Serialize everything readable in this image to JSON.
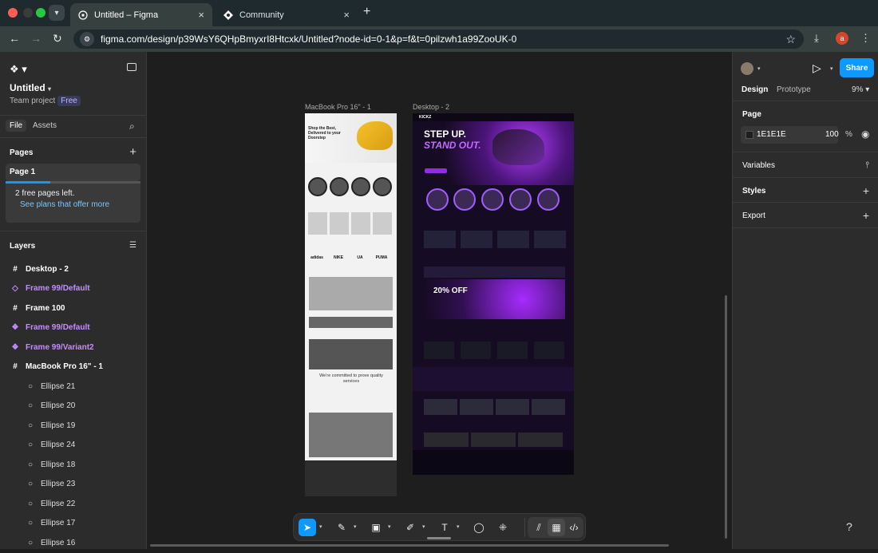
{
  "browser": {
    "tabs": [
      {
        "title": "Untitled – Figma",
        "active": true
      },
      {
        "title": "Community",
        "active": false
      }
    ],
    "url": "figma.com/design/p39WsY6QHpBmyxrI8Htcxk/Untitled?node-id=0-1&p=f&t=0pilzwh1a99ZooUK-0",
    "profile_initial": "a"
  },
  "left_panel": {
    "file_name": "Untitled",
    "team": "Team project",
    "plan_badge": "Free",
    "tabs": [
      "File",
      "Assets"
    ],
    "pages_title": "Pages",
    "pages": [
      "Page 1"
    ],
    "free_pages_text": "2 free pages left.",
    "free_pages_link": "See plans that offer more",
    "free_pages_used_fraction": 0.33,
    "layers_title": "Layers",
    "layers": [
      {
        "name": "Desktop - 2",
        "icon": "frame-icon",
        "level": 0,
        "color": "white"
      },
      {
        "name": "Frame 99/Default",
        "icon": "instance-icon",
        "level": 0,
        "color": "purple"
      },
      {
        "name": "Frame 100",
        "icon": "frame-icon",
        "level": 0,
        "color": "white"
      },
      {
        "name": "Frame 99/Default",
        "icon": "component-icon",
        "level": 0,
        "color": "purple"
      },
      {
        "name": "Frame 99/Variant2",
        "icon": "component-icon",
        "level": 0,
        "color": "purple"
      },
      {
        "name": "MacBook Pro 16\" - 1",
        "icon": "frame-icon",
        "level": 0,
        "color": "white"
      },
      {
        "name": "Ellipse 21",
        "icon": "ellipse-icon",
        "level": 1
      },
      {
        "name": "Ellipse 20",
        "icon": "ellipse-icon",
        "level": 1
      },
      {
        "name": "Ellipse 19",
        "icon": "ellipse-icon",
        "level": 1
      },
      {
        "name": "Ellipse 24",
        "icon": "ellipse-icon",
        "level": 1
      },
      {
        "name": "Ellipse 18",
        "icon": "ellipse-icon",
        "level": 1
      },
      {
        "name": "Ellipse 23",
        "icon": "ellipse-icon",
        "level": 1
      },
      {
        "name": "Ellipse 22",
        "icon": "ellipse-icon",
        "level": 1
      },
      {
        "name": "Ellipse 17",
        "icon": "ellipse-icon",
        "level": 1
      },
      {
        "name": "Ellipse 16",
        "icon": "ellipse-icon",
        "level": 1
      }
    ]
  },
  "canvas": {
    "frames": [
      {
        "label": "MacBook Pro 16\" - 1"
      },
      {
        "label": "Desktop - 2"
      }
    ],
    "frameA": {
      "hero_title": "Shop the Best, Delivered to your Doorstep",
      "brands": [
        "adidas",
        "NIKE",
        "UA",
        "PUMA"
      ],
      "commit_text": "We're committed to prove quality services"
    },
    "frameB": {
      "logo": "KICKZ",
      "hero_line1": "STEP UP.",
      "hero_line2": "STAND OUT.",
      "promo": "20% OFF"
    }
  },
  "toolbar": {
    "tools": [
      "move-icon",
      "pen-icon",
      "image-icon",
      "shape-icon",
      "text-icon",
      "comment-icon",
      "actions-icon"
    ]
  },
  "right_panel": {
    "share_label": "Share",
    "tabs": [
      "Design",
      "Prototype"
    ],
    "zoom": "9%",
    "page_section": "Page",
    "page_color": "1E1E1E",
    "page_opacity": "100",
    "page_opacity_unit": "%",
    "variables": "Variables",
    "styles": "Styles",
    "export": "Export",
    "help": "?"
  }
}
